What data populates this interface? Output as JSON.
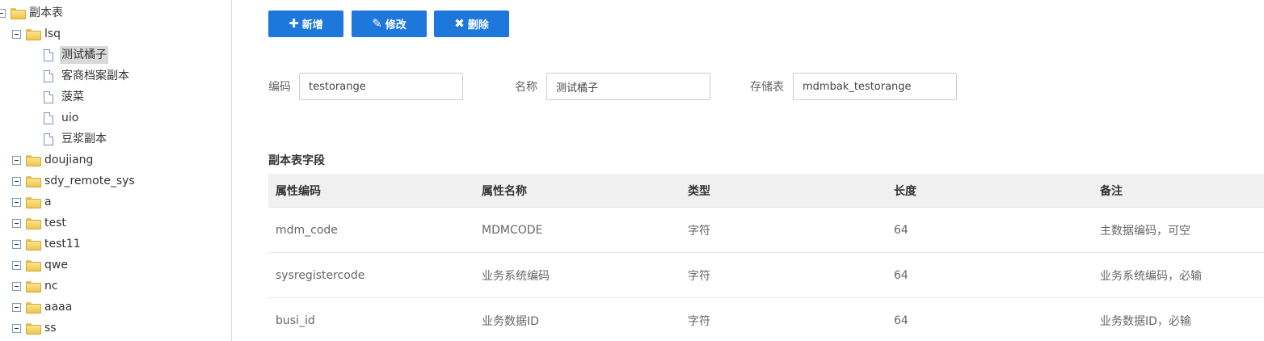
{
  "tree": {
    "root": {
      "label": "副本表"
    },
    "groups": [
      {
        "label": "lsq",
        "children": [
          {
            "label": "测试橘子",
            "selected": true
          },
          {
            "label": "客商档案副本"
          },
          {
            "label": "菠菜"
          },
          {
            "label": "uio"
          },
          {
            "label": "豆浆副本"
          }
        ]
      },
      {
        "label": "doujiang"
      },
      {
        "label": "sdy_remote_sys"
      },
      {
        "label": "a"
      },
      {
        "label": "test"
      },
      {
        "label": "test11"
      },
      {
        "label": "qwe"
      },
      {
        "label": "nc"
      },
      {
        "label": "aaaa"
      },
      {
        "label": "ss"
      }
    ]
  },
  "toolbar": {
    "add_label": "新增",
    "edit_label": "修改",
    "delete_label": "删除",
    "colors": {
      "button_bg": "#1e78dc"
    }
  },
  "form": {
    "code_label": "编码",
    "code_value": "testorange",
    "name_label": "名称",
    "name_value": "测试橘子",
    "storage_label": "存储表",
    "storage_value": "mdmbak_testorange"
  },
  "fields_section": {
    "title": "副本表字段",
    "columns": [
      "属性编码",
      "属性名称",
      "类型",
      "长度",
      "备注"
    ],
    "rows": [
      [
        "mdm_code",
        "MDMCODE",
        "字符",
        "64",
        "主数据编码，可空"
      ],
      [
        "sysregistercode",
        "业务系统编码",
        "字符",
        "64",
        "业务系统编码，必输"
      ],
      [
        "busi_id",
        "业务数据ID",
        "字符",
        "64",
        "业务数据ID，必输"
      ]
    ]
  }
}
